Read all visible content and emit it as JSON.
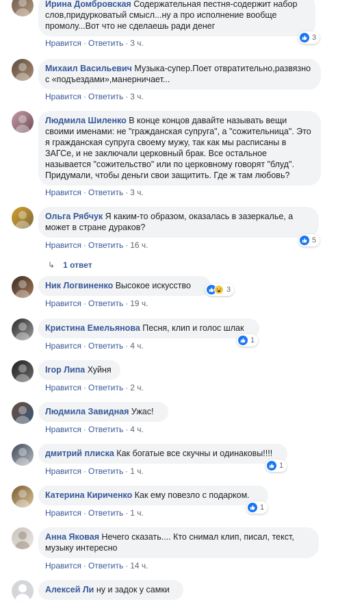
{
  "actions": {
    "like": "Нравится",
    "reply": "Ответить"
  },
  "comments": [
    {
      "author": "Ирина Домбровская",
      "text": "Содержательная пестня-содержит набор слов,придурковатый смысл...ну а про исполнение вообще промолу...Вот что не сделаешь ради денег",
      "time": "3 ч.",
      "reactions": "3"
    },
    {
      "author": "Михаил Васильевич",
      "text": "Музыка-супер.Поет отвратительно,развязно с «подъездами»,манерничает...",
      "time": "3 ч."
    },
    {
      "author": "Людмила Шиленко",
      "text": "В конце концов давайте называть вещи своими именами: не \"гражданская супруга\", а \"сожительница\". Это я гражданская супруга своему мужу, так как мы расписаны в ЗАГСе, и не заключали церковный брак. Все остальное называется \"сожительство\" или по церковному говорят \"блуд\". Придумали, чтобы деньги свои защитить. Где ж там любовь?",
      "time": "3 ч."
    },
    {
      "author": "Ольга Рябчук",
      "text": "Я каким-то образом, оказалась в зазеркалье, а может в стране дураков?",
      "time": "16 ч.",
      "reactions": "5"
    },
    {
      "author": "Ник Логвиненко",
      "text": "Высокое искусство",
      "time": "19 ч.",
      "reactions": "3"
    },
    {
      "author": "Кристина Емельянова",
      "text": "Песня, клип и голос шлак",
      "time": "4 ч.",
      "reactions": "1"
    },
    {
      "author": "Ігор Липа",
      "text": "Хуйня",
      "time": "2 ч."
    },
    {
      "author": "Людмила Завидная",
      "text": "Ужас!",
      "time": "4 ч."
    },
    {
      "author": "дмитрий плиска",
      "text": "Как богатые все скучны и одинаковы!!!!",
      "time": "1 ч.",
      "reactions": "1"
    },
    {
      "author": "Катерина Кириченко",
      "text": "Как ему повезло с подарком.",
      "time": "1 ч.",
      "reactions": "1"
    },
    {
      "author": "Анна Яковая",
      "text": "Нечего сказать.... Кто снимал клип, писал, текст, музыку интересно",
      "time": "14 ч."
    },
    {
      "author": "Алексей Ли",
      "text": "ну и задок у самки"
    }
  ],
  "replies_link": "1 ответ",
  "colors": {
    "link": "#385898",
    "bubble": "#f2f3f5",
    "like": "#1877f2",
    "meta": "#606770"
  },
  "icons": {
    "like": "thumbs-up-icon",
    "haha": "laughing-face-icon",
    "reply_arrow": "reply-arrow-icon"
  }
}
